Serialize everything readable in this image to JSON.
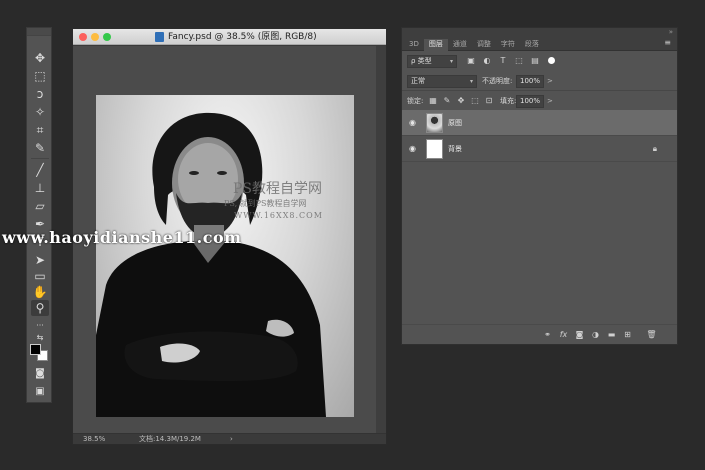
{
  "document": {
    "title": "Fancy.psd @ 38.5% (原图, RGB/8)",
    "zoom": "38.5%",
    "doc_info": "文档:14.3M/19.2M",
    "status_arrow": "›"
  },
  "layers_panel": {
    "tabs": [
      {
        "label": "3D",
        "active": false
      },
      {
        "label": "图层",
        "active": true
      },
      {
        "label": "通道",
        "active": false
      },
      {
        "label": "调整",
        "active": false
      },
      {
        "label": "字符",
        "active": false
      },
      {
        "label": "段落",
        "active": false
      }
    ],
    "collapse_glyph": "»",
    "menu_glyph": "≡",
    "filter": {
      "kind": "ρ 类型",
      "icons": [
        "image-icon",
        "adjustment-icon",
        "type-icon",
        "shape-icon",
        "smart-object-icon"
      ]
    },
    "blend_mode": "正常",
    "opacity_label": "不透明度:",
    "opacity_value": "100%",
    "lock_label": "锁定:",
    "fill_label": "填充:",
    "fill_value": "100%",
    "caret": ">",
    "layers": [
      {
        "name": "原图",
        "visible": true,
        "selected": true,
        "locked": false
      },
      {
        "name": "背景",
        "visible": true,
        "selected": false,
        "locked": true
      }
    ],
    "bottom_icons": [
      "link-icon",
      "fx-icon",
      "mask-icon",
      "adjustment-layer-icon",
      "group-folder-icon",
      "new-layer-icon",
      "trash-icon"
    ]
  },
  "tools": [
    "move-tool",
    "marquee-tool",
    "lasso-tool",
    "magic-wand-tool",
    "crop-tool",
    "eyedropper-tool",
    "brush-tool",
    "clone-stamp-tool",
    "eraser-tool",
    "pen-tool",
    "type-tool",
    "path-selection-tool",
    "rectangle-tool",
    "hand-tool",
    "zoom-tool"
  ],
  "colors": {
    "foreground": "#000000",
    "background": "#ffffff",
    "app_background": "#2a2a2a",
    "panel": "#535353",
    "selected_layer": "#6b6b6b"
  },
  "watermarks": {
    "brand": "PS教程自学网",
    "sub": "PS, 就到PS教程自学网",
    "url_small": "WWW.16XX8.COM",
    "url_big": "www.haoyidianshe11.com"
  }
}
